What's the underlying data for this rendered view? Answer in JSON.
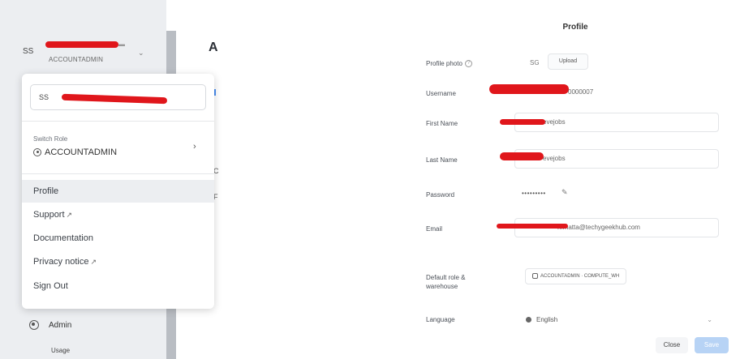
{
  "user_header": {
    "initials": "SS",
    "role": "ACCOUNTADMIN"
  },
  "account_menu": {
    "user_box_initials": "SS",
    "switch_role_label": "Switch Role",
    "current_role": "ACCOUNTADMIN",
    "items": [
      {
        "label": "Profile",
        "external": false,
        "active": true
      },
      {
        "label": "Support",
        "external": true,
        "active": false
      },
      {
        "label": "Documentation",
        "external": false,
        "active": false
      },
      {
        "label": "Privacy notice",
        "external": true,
        "active": false
      },
      {
        "label": "Sign Out",
        "external": false,
        "active": false
      }
    ]
  },
  "sidebar": {
    "admin_label": "Admin",
    "usage_label": "Usage"
  },
  "main_peek": {
    "title_letter": "A",
    "peek_c": "C",
    "peek_f": "F"
  },
  "profile": {
    "title": "Profile",
    "photo_label": "Profile photo",
    "photo_initials": "SG",
    "upload_label": "Upload",
    "username_label": "Username",
    "username_tail": "0000007",
    "first_name_label": "First Name",
    "first_name_value": "evejobs",
    "last_name_label": "Last Name",
    "last_name_value": "evejobs",
    "password_label": "Password",
    "password_value": "•••••••••",
    "email_label": "Email",
    "email_value": "n.matta@techygeekhub.com",
    "default_role_label": "Default role & warehouse",
    "default_role_value": "ACCOUNTADMIN",
    "default_warehouse_value": "COMPUTE_WH",
    "language_label": "Language",
    "language_value": "English",
    "close_label": "Close",
    "save_label": "Save"
  }
}
